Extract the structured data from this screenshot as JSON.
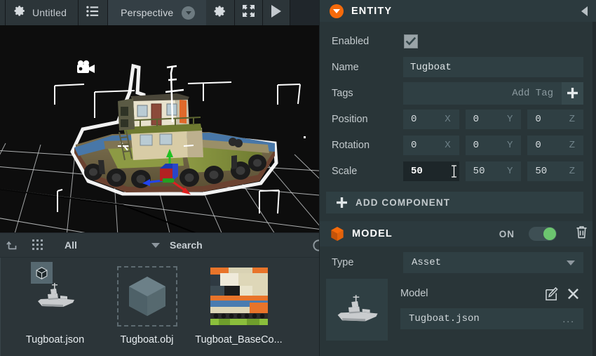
{
  "toolbar": {
    "project_icon": "gear-icon",
    "project_name": "Untitled",
    "hierarchy_icon": "list-icon",
    "camera_label": "Perspective",
    "camera_caret_icon": "circle-caret-down-icon",
    "settings_icon": "gear-icon",
    "fullscreen_icon": "expand-icon",
    "launch_icon": "play-icon"
  },
  "viewport": {
    "camera_gizmo_icon": "camera-icon",
    "selected_object": "Tugboat",
    "gizmo": {
      "x_axis_color": "#e02020",
      "y_axis_color": "#22c022",
      "z_axis_color": "#2244ee"
    },
    "selection_outline_color": "#ffffff",
    "background_color": "#0d0d0d",
    "grid_color": "#b9bcbe"
  },
  "assets": {
    "upload_icon": "upload-arrow-icon",
    "grid_view_icon": "grid-view-icon",
    "filter_label": "All",
    "filter_caret_icon": "caret-down-icon",
    "search_placeholder": "Search",
    "search_value": "",
    "clear_icon": "clear-circle-icon",
    "items": [
      {
        "name": "Tugboat.json",
        "thumb": "ship-model-icon",
        "badge": "cube-badge-icon",
        "selected": true
      },
      {
        "name": "Tugboat.obj",
        "thumb": "cube-icon",
        "badge": null,
        "selected": false
      },
      {
        "name": "Tugboat_BaseCo...",
        "thumb": "texture-thumbnail",
        "badge": null,
        "selected": false
      }
    ]
  },
  "entity_panel": {
    "icon": "orange-circle-caret-icon",
    "title": "ENTITY",
    "collapse_icon": "collapse-left-icon",
    "enabled": {
      "label": "Enabled",
      "checked": true,
      "check_icon": "check-icon"
    },
    "name": {
      "label": "Name",
      "value": "Tugboat"
    },
    "tags": {
      "label": "Tags",
      "placeholder": "Add Tag",
      "value": "",
      "add_icon": "plus-icon"
    },
    "position": {
      "label": "Position",
      "x": "0",
      "y": "0",
      "z": "0"
    },
    "rotation": {
      "label": "Rotation",
      "x": "0",
      "y": "0",
      "z": "0"
    },
    "scale": {
      "label": "Scale",
      "x": "50",
      "y": "50",
      "z": "50",
      "focused_field": "x"
    },
    "axis_labels": {
      "x": "X",
      "y": "Y",
      "z": "Z"
    },
    "add_component": {
      "label": "ADD COMPONENT",
      "icon": "plus-icon"
    }
  },
  "model_panel": {
    "icon": "orange-cube-icon",
    "title": "MODEL",
    "toggle_label": "ON",
    "toggle_on": true,
    "toggle_color": "#6cc56f",
    "delete_icon": "trash-icon",
    "type": {
      "label": "Type",
      "value": "Asset",
      "caret_icon": "caret-down-icon"
    },
    "model": {
      "label": "Model",
      "thumbnail": "ship-model-icon",
      "edit_icon": "edit-square-icon",
      "remove_icon": "close-x-icon",
      "asset_name": "Tugboat.json",
      "more_icon": "ellipsis-icon"
    }
  },
  "theme": {
    "accent": "#f56a0b",
    "panel_bg": "#293538",
    "panel_header_bg": "#2c3a3e",
    "field_bg": "#2f3f43",
    "toolbar_bg": "#2c3539",
    "app_bg": "#20262b"
  }
}
